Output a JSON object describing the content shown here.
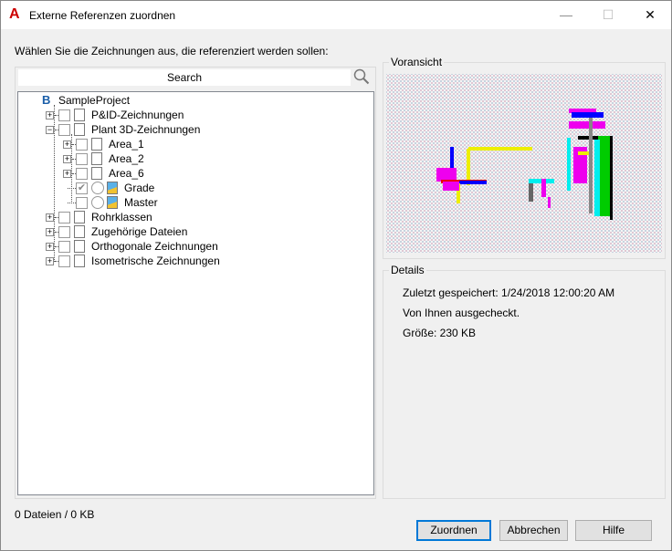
{
  "window": {
    "title": "Externe Referenzen zuordnen",
    "minimize": "—",
    "maximize": "☐",
    "close": "✕",
    "app_icon": "A"
  },
  "instruction": "Wählen Sie die Zeichnungen aus, die referenziert werden sollen:",
  "search": {
    "placeholder": "Search",
    "icon": "search-icon"
  },
  "tree": [
    {
      "label": "SampleProject",
      "level": 0,
      "type": "project"
    },
    {
      "label": "P&ID-Zeichnungen",
      "level": 1,
      "expander": "+",
      "type": "folder"
    },
    {
      "label": "Plant 3D-Zeichnungen",
      "level": 1,
      "expander": "-",
      "type": "folder"
    },
    {
      "label": "Area_1",
      "level": 2,
      "expander": "+",
      "type": "file"
    },
    {
      "label": "Area_2",
      "level": 2,
      "expander": "+",
      "type": "file"
    },
    {
      "label": "Area_6",
      "level": 2,
      "expander": "+",
      "type": "file"
    },
    {
      "label": "Grade",
      "level": 2,
      "type": "drawing",
      "checked": true,
      "radio": true
    },
    {
      "label": "Master",
      "level": 2,
      "type": "drawing",
      "checked": false,
      "radio": true
    },
    {
      "label": "Rohrklassen",
      "level": 1,
      "expander": "+",
      "type": "folder"
    },
    {
      "label": "Zugehörige Dateien",
      "level": 1,
      "expander": "+",
      "type": "file"
    },
    {
      "label": "Orthogonale Zeichnungen",
      "level": 1,
      "expander": "+",
      "type": "folder"
    },
    {
      "label": "Isometrische Zeichnungen",
      "level": 1,
      "expander": "+",
      "type": "folder"
    }
  ],
  "preview": {
    "label": "Voransicht"
  },
  "details": {
    "label": "Details",
    "saved": "Zuletzt gespeichert: 1/24/2018 12:00:20 AM",
    "checkout": "Von Ihnen ausgecheckt.",
    "size": "Größe: 230 KB"
  },
  "status": "0 Dateien / 0 KB",
  "buttons": {
    "ok": "Zuordnen",
    "cancel": "Abbrechen",
    "help": "Hilfe"
  },
  "colors": {
    "accent": "#0078d7",
    "app_icon": "#cc0000"
  }
}
